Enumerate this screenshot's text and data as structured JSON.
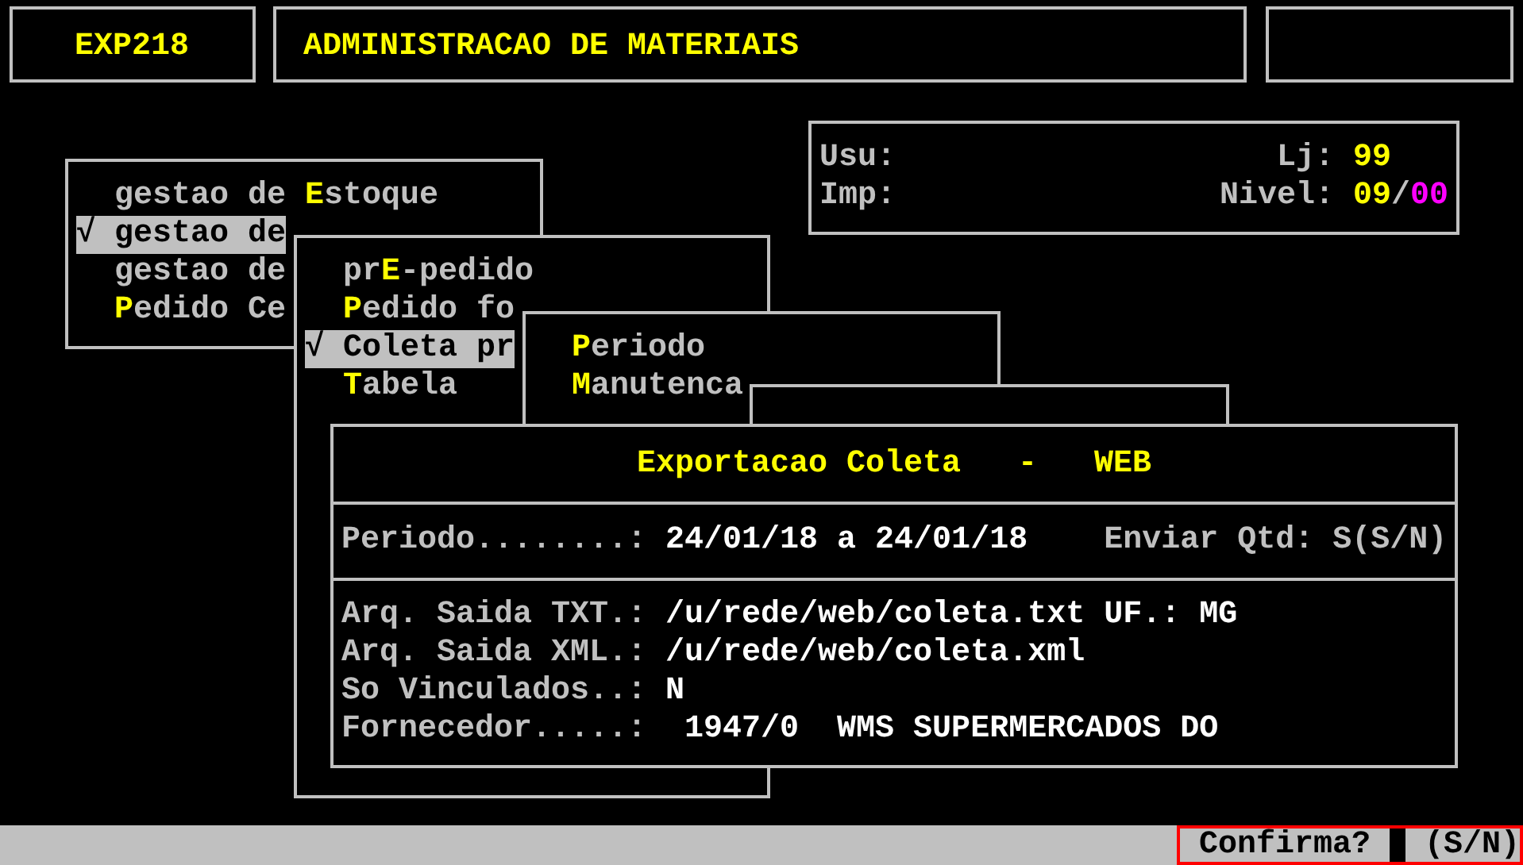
{
  "header": {
    "program": "EXP218",
    "title": "ADMINISTRACAO DE MATERIAIS"
  },
  "info": {
    "user_label": "Usu:",
    "printer_label": "Imp:",
    "store_label": "Lj:",
    "store": "99",
    "level_label": "Nivel:",
    "level_major": "09",
    "level_sep": "/",
    "level_minor": "00"
  },
  "menus": [
    {
      "items": [
        {
          "before": "gestao de ",
          "hotkey": "E",
          "after": "stoque",
          "selected": false
        },
        {
          "mark": "√",
          "before": "gestao de",
          "selected": true
        },
        {
          "before": "gestao de",
          "selected": false
        },
        {
          "hotkey": "P",
          "after": "edido Ce",
          "selected": false
        }
      ]
    },
    {
      "items": [
        {
          "before": "pr",
          "hotkey": "E",
          "after": "-pedido",
          "selected": false
        },
        {
          "hotkey": "P",
          "after": "edido fo",
          "selected": false
        },
        {
          "mark": "√",
          "before": "Coleta pr",
          "selected": true
        },
        {
          "hotkey": "T",
          "after": "abela",
          "selected": false
        }
      ]
    },
    {
      "items": [
        {
          "hotkey": "P",
          "after": "eriodo",
          "selected": false
        },
        {
          "hotkey": "M",
          "after": "anutenca",
          "selected": false
        }
      ]
    }
  ],
  "dialog": {
    "title": "Exportacao Coleta   -   WEB",
    "period": {
      "label": "Periodo........:",
      "from": "24/01/18",
      "joiner": "a",
      "to": "24/01/18",
      "qty_label": "Enviar Qtd:",
      "qty_value": "S(S/N)"
    },
    "fields": [
      {
        "label": "Arq. Saida TXT.:",
        "value": "/u/rede/web/coleta.txt",
        "extra_label": "UF.:",
        "extra_value": "MG"
      },
      {
        "label": "Arq. Saida XML.:",
        "value": "/u/rede/web/coleta.xml"
      },
      {
        "label": "So Vinculados..:",
        "value": "N"
      },
      {
        "label": "Fornecedor.....:",
        "value": " 1947/0  WMS SUPERMERCADOS DO"
      }
    ]
  },
  "status_bar": {
    "prompt": "Confirma?",
    "options": "(S/N)"
  }
}
